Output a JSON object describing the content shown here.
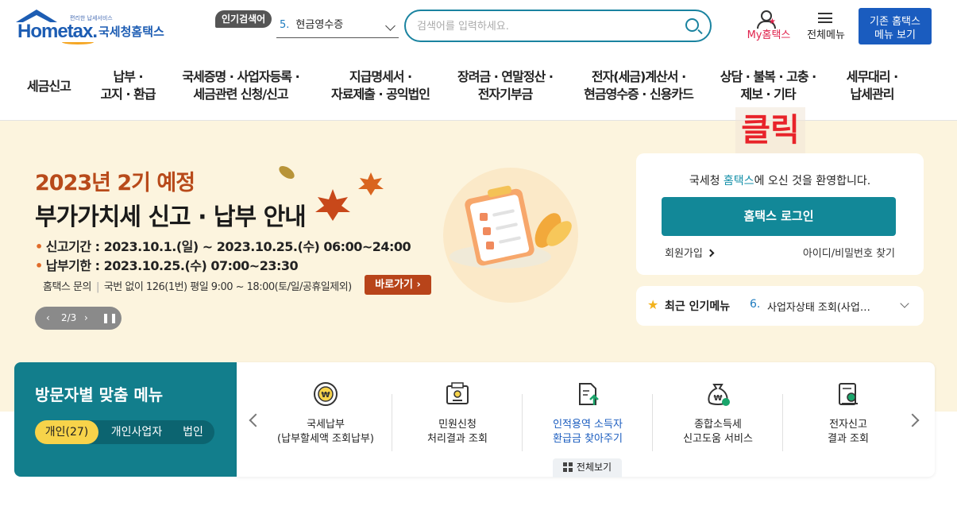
{
  "header": {
    "logo_small": "편리한 납세서비스",
    "logo_text": "Hometax.",
    "logo_org": "국세청홈택스",
    "popular_badge": "인기검색어",
    "popular_keyword_num": "5.",
    "popular_keyword": "현금영수증",
    "search_placeholder": "검색어를 입력하세요.",
    "my_hometax": "My홈택스",
    "all_menu": "전체메뉴",
    "old_menu_line1": "기존 홈택스",
    "old_menu_line2": "메뉴 보기"
  },
  "nav": [
    {
      "l1": "세금신고",
      "l2": ""
    },
    {
      "l1": "납부 ·",
      "l2": "고지 · 환급"
    },
    {
      "l1": "국세증명 · 사업자등록 ·",
      "l2": "세금관련 신청/신고"
    },
    {
      "l1": "지급명세서 ·",
      "l2": "자료제출 · 공익법인"
    },
    {
      "l1": "장려금 · 연말정산 ·",
      "l2": "전자기부금"
    },
    {
      "l1": "전자(세금)계산서 ·",
      "l2": "현금영수증 · 신용카드"
    },
    {
      "l1": "상담 · 불복 · 고충 ·",
      "l2": "제보 · 기타"
    },
    {
      "l1": "세무대리 ·",
      "l2": "납세관리"
    }
  ],
  "overlay": {
    "click_label": "클릭"
  },
  "banner": {
    "title1": "2023년 2기 예정",
    "title2": "부가가치세 신고 · 납부 안내",
    "line1": "신고기간 : 2023.10.1.(일) ~ 2023.10.25.(수) 06:00~24:00",
    "line2": "납부기한 : 2023.10.25.(수) 07:00~23:30",
    "inquiry_label": "홈택스 문의",
    "inquiry_text": "국번 없이 126(1번) 평일 9:00 ~ 18:00(토/일/공휴일제외)",
    "go_button": "바로가기",
    "pager": "2/3"
  },
  "welcome": {
    "prefix": "국세청 ",
    "highlight": "홈택스",
    "suffix": "에 오신 것을 환영합니다.",
    "login_button": "홈택스 로그인",
    "join": "회원가입",
    "find": "아이디/비밀번호 찾기"
  },
  "popular_menu": {
    "label": "최근 인기메뉴",
    "num": "6.",
    "text": "사업자상태 조회(사업…"
  },
  "visitor": {
    "title": "방문자별 맞춤 메뉴",
    "segments": [
      "개인(27)",
      "개인사업자",
      "법인"
    ]
  },
  "quick": {
    "items": [
      {
        "l1": "국세납부",
        "l2": "(납부할세액 조회납부)",
        "icon": "won-coin-icon"
      },
      {
        "l1": "민원신청",
        "l2": "처리결과 조회",
        "icon": "certificate-icon"
      },
      {
        "l1": "인적용역 소득자",
        "l2": "환급금 찾아주기",
        "icon": "document-upload-icon"
      },
      {
        "l1": "종합소득세",
        "l2": "신고도움 서비스",
        "icon": "money-bag-icon"
      },
      {
        "l1": "전자신고",
        "l2": "결과 조회",
        "icon": "report-result-icon"
      }
    ],
    "view_all": "전체보기"
  },
  "colors": {
    "accent": "#128898",
    "brand": "#1d5db3",
    "click": "#e8232a",
    "hero_bg": "#fcf4de"
  }
}
